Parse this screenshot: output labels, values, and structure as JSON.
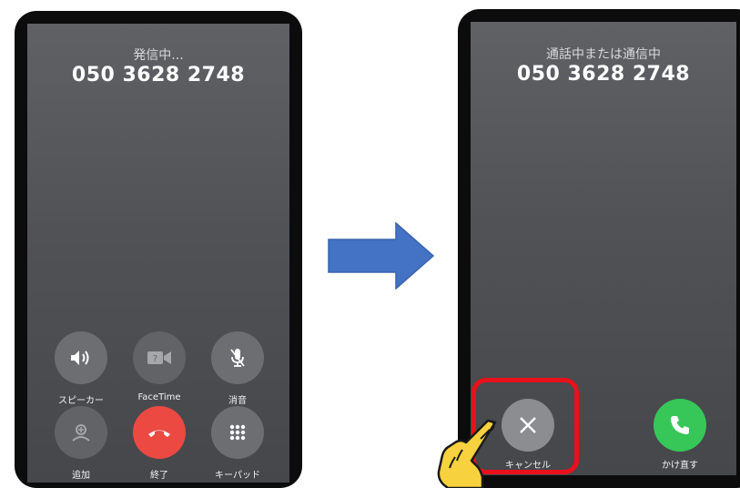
{
  "left_screen": {
    "status": "発信中...",
    "number": "050 3628 2748",
    "buttons": [
      {
        "label": "スピーカー",
        "icon": "speaker-icon"
      },
      {
        "label": "FaceTime",
        "icon": "facetime-camera-icon"
      },
      {
        "label": "消音",
        "icon": "mute-mic-icon"
      },
      {
        "label": "追加",
        "icon": "add-call-icon"
      },
      {
        "label": "終了",
        "icon": "end-call-icon"
      },
      {
        "label": "キーパッド",
        "icon": "keypad-icon"
      }
    ]
  },
  "right_screen": {
    "status": "通話中または通信中",
    "number": "050 3628 2748",
    "buttons": [
      {
        "label": "キャンセル",
        "icon": "close-icon"
      },
      {
        "label": "かけ直す",
        "icon": "phone-icon"
      }
    ]
  },
  "colors": {
    "end_call": "#eb4942",
    "call_again": "#37c759",
    "arrow": "#4472c4",
    "highlight": "#e8111c"
  },
  "decor": {
    "transition_arrow": "right-arrow-icon",
    "pointer": "pointing-hand-icon"
  }
}
